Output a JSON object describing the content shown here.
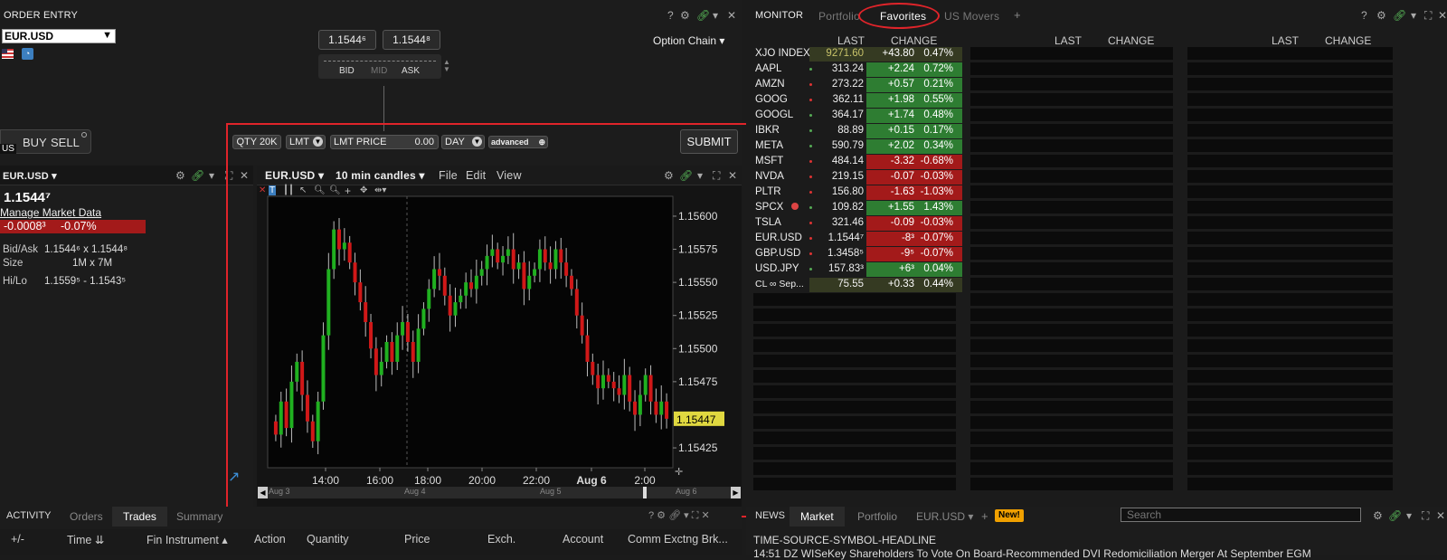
{
  "order_entry": {
    "title": "ORDER ENTRY",
    "symbol": "EUR.USD",
    "bid": "1.1544⁶",
    "ask": "1.1544⁸",
    "bid_label": "BID",
    "mid_label": "MID",
    "ask_label": "ASK",
    "option_chain": "Option Chain",
    "buy": "BUY",
    "sell": "SELL",
    "side_tab": "US",
    "qty": "QTY 20K",
    "order_type": "LMT",
    "lmt_price_label": "LMT PRICE",
    "lmt_price_value": "0.00",
    "tif": "DAY",
    "advanced": "advanced",
    "submit": "SUBMIT"
  },
  "quote": {
    "symbol": "EUR.USD",
    "last": "1.1544⁷",
    "manage": "Manage Market Data",
    "change": "-0.0008³",
    "change_pct": "-0.07%",
    "bidask_label": "Bid/Ask",
    "bidask_value": "1.1544⁶ x 1.1544⁸",
    "size_label": "Size",
    "size_value": "1M x 7M",
    "hilo_label": "Hi/Lo",
    "hilo_value": "1.1559⁵ - 1.1543⁵"
  },
  "chart_panel": {
    "symbol": "EUR.USD",
    "interval": "10 min candles",
    "menu_file": "File",
    "menu_edit": "Edit",
    "menu_view": "View",
    "last_badge": "1.15447",
    "nav_labels": [
      "Aug 3",
      "Aug 4",
      "Aug 5",
      "Aug 6"
    ]
  },
  "chart_data": {
    "type": "candlestick",
    "title": "",
    "xlabel": "",
    "ylabel": "",
    "ylim": [
      1.1541,
      1.15615
    ],
    "y_ticks": [
      "1.15600",
      "1.15575",
      "1.15550",
      "1.15525",
      "1.15500",
      "1.15475",
      "1.15425"
    ],
    "x_ticks": [
      "14:00",
      "16:00",
      "18:00",
      "20:00",
      "22:00",
      "Aug 6",
      "2:00"
    ],
    "close_series": [
      1.15435,
      1.1546,
      1.1544,
      1.15475,
      1.1549,
      1.15465,
      1.15445,
      1.1543,
      1.1546,
      1.1551,
      1.1556,
      1.1559,
      1.15575,
      1.1558,
      1.15565,
      1.1555,
      1.15535,
      1.1552,
      1.155,
      1.1548,
      1.1549,
      1.15505,
      1.1549,
      1.1551,
      1.1552,
      1.15505,
      1.1549,
      1.15515,
      1.1553,
      1.15545,
      1.1556,
      1.15555,
      1.1554,
      1.15525,
      1.15535,
      1.1554,
      1.1555,
      1.15545,
      1.15555,
      1.1556,
      1.1557,
      1.15575,
      1.15565,
      1.1557,
      1.15575,
      1.1556,
      1.15565,
      1.15545,
      1.15555,
      1.1556,
      1.15575,
      1.15565,
      1.1556,
      1.15575,
      1.15565,
      1.15555,
      1.15545,
      1.15525,
      1.1551,
      1.1549,
      1.1548,
      1.1547,
      1.1548,
      1.15475,
      1.1547,
      1.15465,
      1.1548,
      1.1546,
      1.1545,
      1.15465,
      1.1548,
      1.1546,
      1.1545,
      1.1546,
      1.15447
    ],
    "last": 1.15447
  },
  "monitor": {
    "tabs": [
      "MONITOR",
      "Portfolio",
      "Favorites",
      "US Movers"
    ],
    "col_last": "LAST",
    "col_change": "CHANGE",
    "rows": [
      {
        "sym": "XJO INDEX",
        "last": "9271.60",
        "chg": "+43.80",
        "pct": "0.47%",
        "dir": "flat"
      },
      {
        "sym": "AAPL",
        "last": "313.24",
        "chg": "+2.24",
        "pct": "0.72%",
        "dir": "up"
      },
      {
        "sym": "AMZN",
        "last": "273.22",
        "chg": "+0.57",
        "pct": "0.21%",
        "dir": "up"
      },
      {
        "sym": "GOOG",
        "last": "362.11",
        "chg": "+1.98",
        "pct": "0.55%",
        "dir": "up"
      },
      {
        "sym": "GOOGL",
        "last": "364.17",
        "chg": "+1.74",
        "pct": "0.48%",
        "dir": "up"
      },
      {
        "sym": "IBKR",
        "last": "88.89",
        "chg": "+0.15",
        "pct": "0.17%",
        "dir": "up"
      },
      {
        "sym": "META",
        "last": "590.79",
        "chg": "+2.02",
        "pct": "0.34%",
        "dir": "up"
      },
      {
        "sym": "MSFT",
        "last": "484.14",
        "chg": "-3.32",
        "pct": "-0.68%",
        "dir": "down"
      },
      {
        "sym": "NVDA",
        "last": "219.15",
        "chg": "-0.07",
        "pct": "-0.03%",
        "dir": "down"
      },
      {
        "sym": "PLTR",
        "last": "156.80",
        "chg": "-1.63",
        "pct": "-1.03%",
        "dir": "down"
      },
      {
        "sym": "SPCX",
        "last": "109.82",
        "chg": "+1.55",
        "pct": "1.43%",
        "dir": "up"
      },
      {
        "sym": "TSLA",
        "last": "321.46",
        "chg": "-0.09",
        "pct": "-0.03%",
        "dir": "down"
      },
      {
        "sym": "EUR.USD",
        "last": "1.1544⁷",
        "chg": "-8³",
        "pct": "-0.07%",
        "dir": "down"
      },
      {
        "sym": "GBP.USD",
        "last": "1.3458⁵",
        "chg": "-9⁵",
        "pct": "-0.07%",
        "dir": "down"
      },
      {
        "sym": "USD.JPY",
        "last": "157.83³",
        "chg": "+6³",
        "pct": "0.04%",
        "dir": "up"
      },
      {
        "sym": "CL ∞ Sep...",
        "last": "75.55",
        "chg": "+0.33",
        "pct": "0.44%",
        "dir": "flat"
      }
    ]
  },
  "activity": {
    "tabs": [
      "ACTIVITY",
      "Orders",
      "Trades",
      "Summary"
    ],
    "columns": [
      "+/-",
      "Time",
      "Fin Instrument",
      "Action",
      "Quantity",
      "Price",
      "Exch.",
      "Account",
      "Comm",
      "Exctng Brk..."
    ]
  },
  "news": {
    "tabs": [
      "NEWS",
      "Market",
      "Portfolio",
      "EUR.USD"
    ],
    "new_badge": "New!",
    "search_placeholder": "Search",
    "header": "TIME-SOURCE-SYMBOL-HEADLINE",
    "headline": "14:51 DZ WISeKey Shareholders To Vote On Board-Recommended DVI Redomiciliation Merger At September EGM"
  },
  "colors": {
    "up": "#2e7d32",
    "down": "#a31a1a",
    "red_mark": "#e0242a",
    "candle_up": "#20b020",
    "candle_down": "#d01818"
  }
}
